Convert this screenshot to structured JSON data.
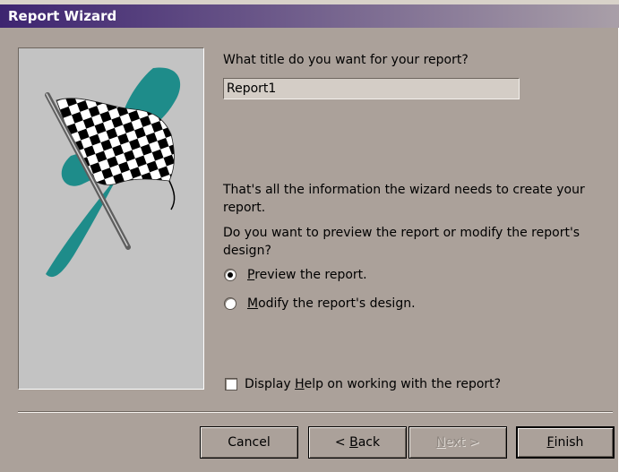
{
  "window": {
    "title": "Report Wizard"
  },
  "question_title": "What title do you want for your report?",
  "title_input": {
    "value": "Report1"
  },
  "info_text": "That's all the information the wizard needs to create your report.",
  "question_preview": "Do you want to preview the report or modify the report's design?",
  "options": [
    {
      "mnemonic": "P",
      "rest": "review the report.",
      "checked": true
    },
    {
      "mnemonic": "M",
      "rest": "odify the report's design.",
      "checked": false
    }
  ],
  "help_checkbox": {
    "before": "Display ",
    "mnemonic": "H",
    "after": "elp on working with the report?",
    "checked": false
  },
  "buttons": {
    "cancel": "Cancel",
    "back": {
      "prefix": "< ",
      "mnemonic": "B",
      "rest": "ack"
    },
    "next": {
      "mnemonic": "N",
      "rest": "ext >",
      "enabled": false
    },
    "finish": {
      "mnemonic": "F",
      "rest": "inish"
    }
  },
  "colors": {
    "dialog_bg": "#aba19a",
    "titlebar_start": "#3d2470",
    "art_bg": "#c3c3c3",
    "teal_brush": "#1e8c8a"
  },
  "icons": [
    "checkered-flag-illustration"
  ]
}
